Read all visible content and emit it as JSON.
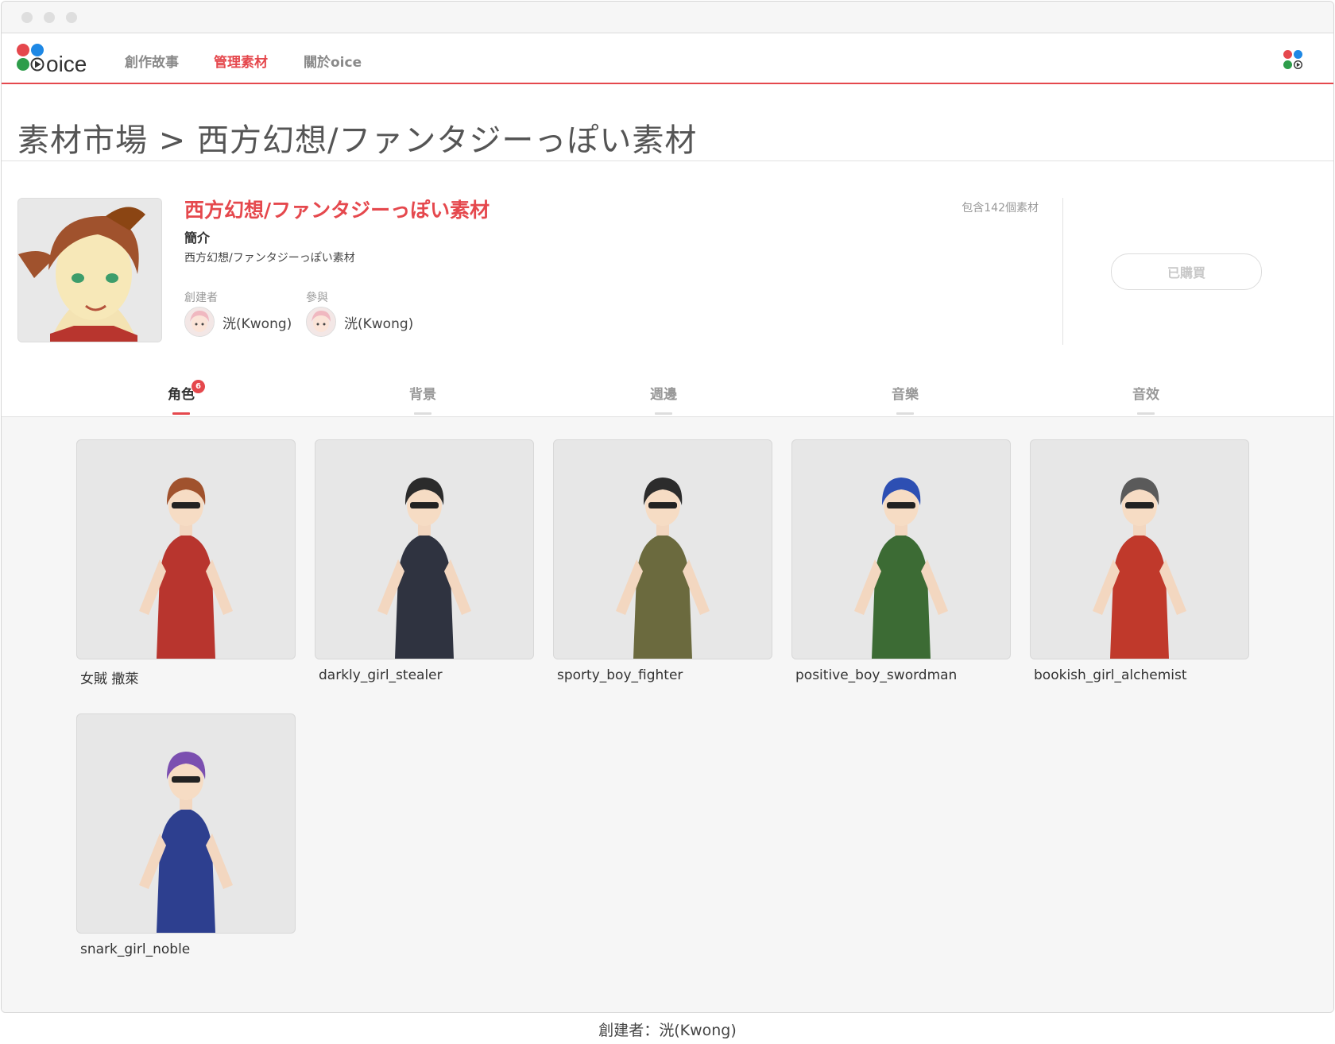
{
  "app": {
    "logo_text": "oice"
  },
  "nav": {
    "items": [
      {
        "label": "創作故事",
        "active": false
      },
      {
        "label": "管理素材",
        "active": true
      },
      {
        "label": "關於oice",
        "active": false
      }
    ]
  },
  "breadcrumb": {
    "text": "素材市場 > 西方幻想/ファンタジーっぽい素材"
  },
  "library": {
    "name": "西方幻想/ファンタジーっぽい素材",
    "count_text": "包含142個素材",
    "intro_label": "簡介",
    "intro_text": "西方幻想/ファンタジーっぽい素材",
    "creator_label": "創建者",
    "creator_name": "洸(Kwong)",
    "contributor_label": "參與",
    "contributor_name": "洸(Kwong)",
    "buy_button_label": "已購買"
  },
  "tabs": [
    {
      "label": "角色",
      "badge": "6",
      "active": true
    },
    {
      "label": "背景",
      "active": false
    },
    {
      "label": "週邊",
      "active": false
    },
    {
      "label": "音樂",
      "active": false
    },
    {
      "label": "音效",
      "active": false
    }
  ],
  "characters": [
    {
      "name": "女賊 撒萊",
      "hair": "#a0522d",
      "outfit": "#b8352e"
    },
    {
      "name": "darkly_girl_stealer",
      "hair": "#2b2b2b",
      "outfit": "#2f3340"
    },
    {
      "name": "sporty_boy_fighter",
      "hair": "#2c2c2c",
      "outfit": "#6b6a3e"
    },
    {
      "name": "positive_boy_swordman",
      "hair": "#2d4fb3",
      "outfit": "#3c6b34"
    },
    {
      "name": "bookish_girl_alchemist",
      "hair": "#5a5a5a",
      "outfit": "#c0392b"
    },
    {
      "name": "snark_girl_noble",
      "hair": "#7b4fb0",
      "outfit": "#2d3f8f"
    }
  ],
  "footer": {
    "credit": "創建者：洸(Kwong)"
  },
  "colors": {
    "accent": "#e5484d",
    "logo_red": "#e5484d",
    "logo_blue": "#1e88e5",
    "logo_green": "#2e9d4b"
  }
}
